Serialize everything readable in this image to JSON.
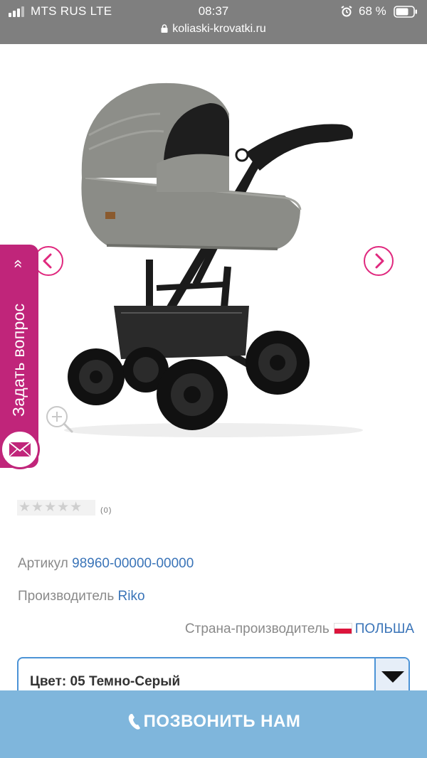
{
  "status_bar": {
    "carrier": "MTS RUS LTE",
    "time": "08:37",
    "battery_percent": "68 %",
    "url": "koliaski-krovatki.ru"
  },
  "gallery": {
    "image_icon": "stroller-image",
    "prev_icon": "chevron-left-icon",
    "next_icon": "chevron-right-icon",
    "zoom_icon": "zoom-in-icon"
  },
  "ask_tab": {
    "label": "Задать вопрос",
    "chevrons": "»",
    "icon": "mail-icon"
  },
  "rating": {
    "stars": "★★★★★",
    "count": "(0)",
    "value": 0
  },
  "specs": {
    "sku_label": "Артикул",
    "sku_value": "98960-00000-00000",
    "maker_label": "Производитель",
    "maker_value": "Riko",
    "country_label": "Страна-производитель",
    "country_value": "ПОЛЬША"
  },
  "color_select": {
    "label": "Цвет: 05 Темно-Серый"
  },
  "call_bar": {
    "label": "ПОЗВОНИТЬ НАМ"
  },
  "colors": {
    "accent_pink": "#c0257a",
    "link_blue": "#3a74b8",
    "call_bar": "#7fb6dc",
    "select_border": "#4c93d6"
  }
}
